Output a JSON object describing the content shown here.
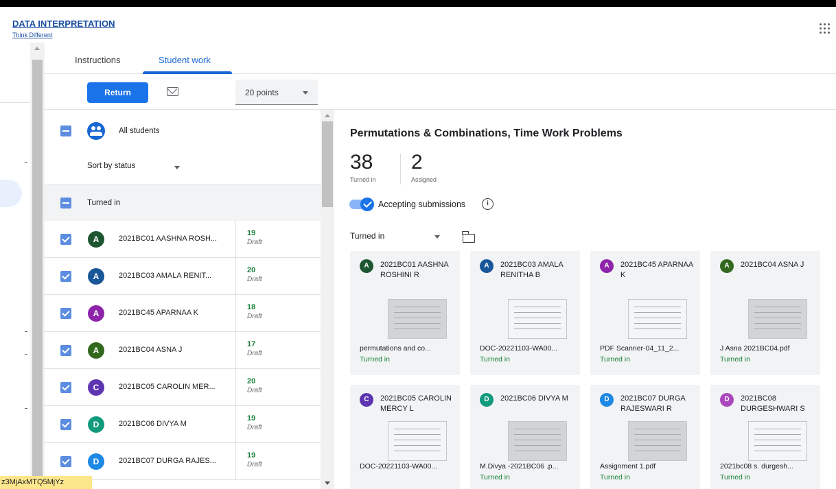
{
  "header": {
    "app_title": "DATA INTERPRETATION",
    "app_subtitle": "Think Different"
  },
  "tabs": [
    {
      "label": "Instructions",
      "active": false
    },
    {
      "label": "Student work",
      "active": true
    }
  ],
  "toolbar": {
    "return_label": "Return",
    "points_value": "20 points"
  },
  "student_list": {
    "all_label": "All students",
    "sort_label": "Sort by status",
    "section_label": "Turned in",
    "students": [
      {
        "initial": "A",
        "color": "#1e5631",
        "name": "2021BC01 AASHNA ROSH...",
        "grade": "19",
        "status": "Draft"
      },
      {
        "initial": "A",
        "color": "#1a5799",
        "name": "2021BC03 AMALA RENIT...",
        "grade": "20",
        "status": "Draft"
      },
      {
        "initial": "A",
        "color": "#8e24aa",
        "name": "2021BC45 APARNAA K",
        "grade": "18",
        "status": "Draft"
      },
      {
        "initial": "A",
        "color": "#33691e",
        "name": "2021BC04 ASNA J",
        "grade": "17",
        "status": "Draft"
      },
      {
        "initial": "C",
        "color": "#5e35b1",
        "name": "2021BC05 CAROLIN MER...",
        "grade": "20",
        "status": "Draft"
      },
      {
        "initial": "D",
        "color": "#129a7d",
        "name": "2021BC06 DIVYA M",
        "grade": "19",
        "status": "Draft"
      },
      {
        "initial": "D",
        "color": "#1e88e5",
        "name": "2021BC07 DURGA RAJES...",
        "grade": "19",
        "status": "Draft"
      }
    ]
  },
  "assignment": {
    "title": "Permutations & Combinations, Time Work Problems",
    "turned_in_count": "38",
    "turned_in_label": "Turned in",
    "assigned_count": "2",
    "assigned_label": "Assigned",
    "accepting_label": "Accepting submissions",
    "info_icon": "i",
    "filter_label": "Turned in"
  },
  "cards": [
    {
      "initial": "A",
      "color": "#1e5631",
      "name": "2021BC01 AASHNA ROSHINI R",
      "file": "permutations and co...",
      "status": "Turned in",
      "light": false
    },
    {
      "initial": "A",
      "color": "#1a5799",
      "name": "2021BC03 AMALA RENITHA B",
      "file": "DOC-20221103-WA00...",
      "status": "Turned in",
      "light": true
    },
    {
      "initial": "A",
      "color": "#8e24aa",
      "name": "2021BC45 APARNAA K",
      "file": "PDF Scanner-04_11_2...",
      "status": "Turned in",
      "light": true
    },
    {
      "initial": "A",
      "color": "#33691e",
      "name": "2021BC04 ASNA J",
      "file": "J Asna 2021BC04.pdf",
      "status": "Turned in",
      "light": false
    },
    {
      "initial": "C",
      "color": "#5e35b1",
      "name": "2021BC05 CAROLIN MERCY L",
      "file": "DOC-20221103-WA00...",
      "status": "",
      "light": true
    },
    {
      "initial": "D",
      "color": "#129a7d",
      "name": "2021BC06 DIVYA M",
      "file": "M.Divya -2021BC06 .p...",
      "status": "Turned in",
      "light": false
    },
    {
      "initial": "D",
      "color": "#1e88e5",
      "name": "2021BC07 DURGA RAJESWARI R",
      "file": "Assignment 1.pdf",
      "status": "Turned in",
      "light": false
    },
    {
      "initial": "D",
      "color": "#ab47bc",
      "name": "2021BC08 DURGESHWARI S",
      "file": "2021bc08 s. durgesh...",
      "status": "Turned in",
      "light": true
    }
  ],
  "footer_tag": "z3MjAxMTQ5MjYz"
}
